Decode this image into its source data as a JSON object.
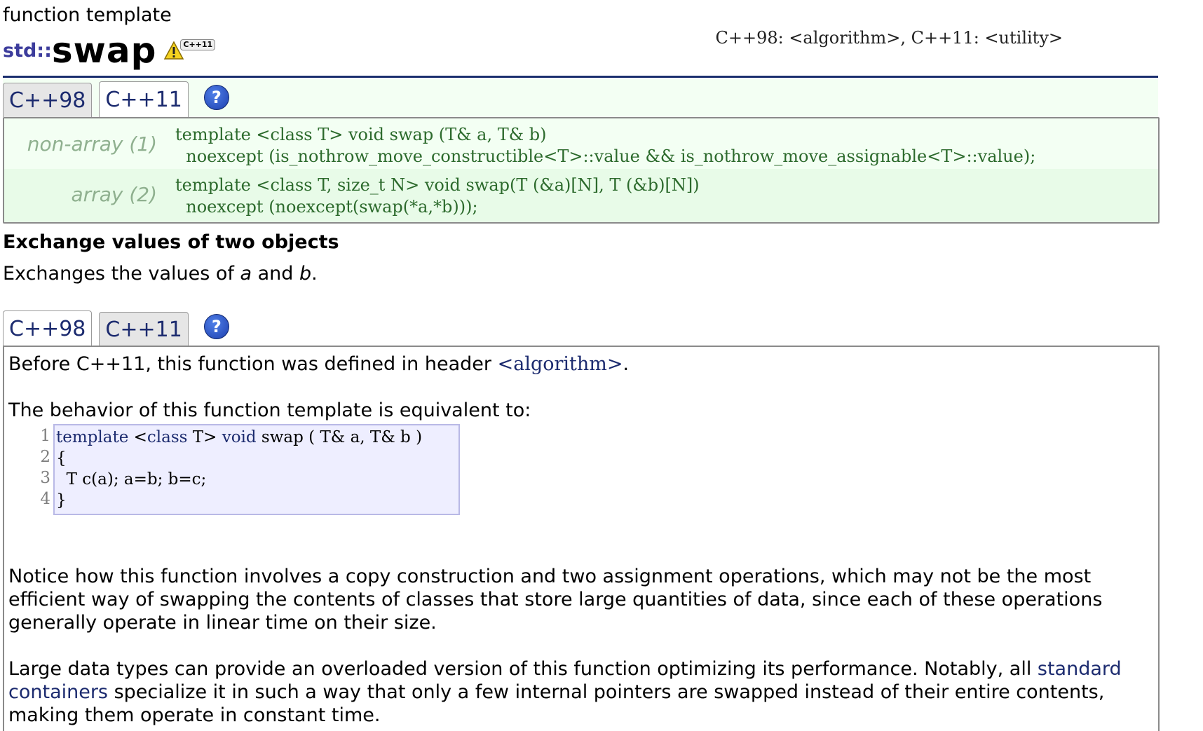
{
  "page": {
    "kind_label": "function template",
    "namespace": "std::",
    "name": "swap",
    "badge": "C++11",
    "header_info": "C++98: <algorithm>, C++11: <utility>"
  },
  "prototype_tabs": [
    {
      "label": "C++98",
      "active": false
    },
    {
      "label": "C++11",
      "active": true
    }
  ],
  "help_icon": "?",
  "prototypes": [
    {
      "label": "non-array (1)",
      "line1": "template <class T> void swap (T& a, T& b)",
      "line2": "noexcept (is_nothrow_move_constructible<T>::value && is_nothrow_move_assignable<T>::value);"
    },
    {
      "label": "array (2)",
      "line1": "template <class T, size_t N> void swap(T (&a)[N], T (&b)[N])",
      "line2": "noexcept (noexcept(swap(*a,*b)));"
    }
  ],
  "section": {
    "heading": "Exchange values of two objects",
    "lead_prefix": "Exchanges the values of ",
    "lead_a": "a",
    "lead_and": " and ",
    "lead_b": "b",
    "lead_suffix": "."
  },
  "desc_tabs": [
    {
      "label": "C++98",
      "active": true
    },
    {
      "label": "C++11",
      "active": false
    }
  ],
  "description": {
    "p1_prefix": "Before C++11, this function was defined in header ",
    "p1_header": "<algorithm>",
    "p1_suffix": ".",
    "p2": "The behavior of this function template is equivalent to:",
    "code_lines": [
      {
        "num": "1",
        "kw1": "template",
        "mid1": " <",
        "kw2": "class",
        "mid2": " T> ",
        "kw3": "void",
        "rest": " swap ( T& a, T& b )"
      },
      {
        "num": "2",
        "text": "{"
      },
      {
        "num": "3",
        "text": "  T c(a); a=b; b=c;"
      },
      {
        "num": "4",
        "text": "}"
      }
    ],
    "p3": "Notice how this function involves a copy construction and two assignment operations, which may not be the most efficient way of swapping the contents of classes that store large quantities of data, since each of these operations generally operate in linear time on their size.",
    "p4_prefix": "Large data types can provide an overloaded version of this function optimizing its performance. Notably, all ",
    "p4_link": "standard containers",
    "p4_suffix": " specialize it in such a way that only a few internal pointers are swapped instead of their entire contents, making them operate in constant time."
  }
}
